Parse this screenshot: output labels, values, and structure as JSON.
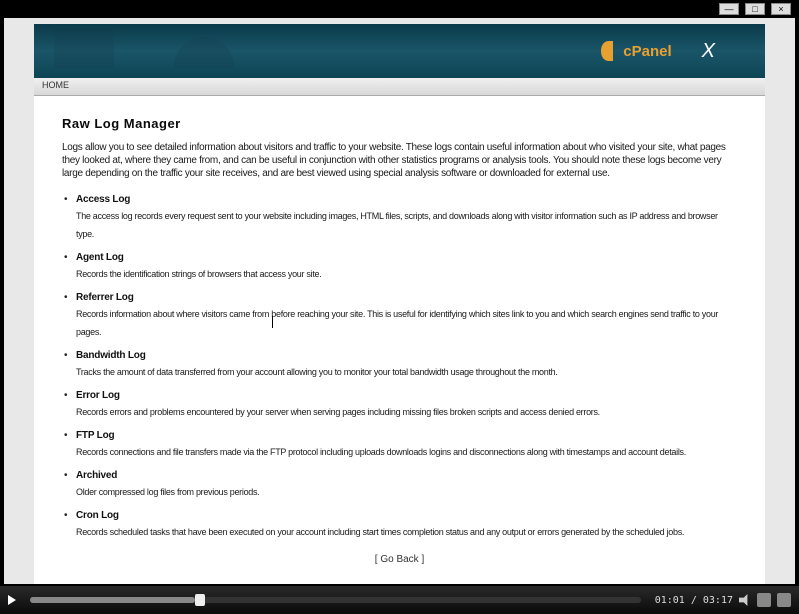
{
  "window": {
    "minimize": "—",
    "maximize": "□",
    "close": "×"
  },
  "header": {
    "logo_text": "cPanel",
    "theme_badge": "X"
  },
  "toolbar": {
    "breadcrumb": "HOME"
  },
  "page": {
    "title": "Raw Log Manager",
    "intro": "Logs allow you to see detailed information about visitors and traffic to your website. These logs contain useful information about who visited your site, what pages they looked at, where they came from, and can be useful in conjunction with other statistics programs or analysis tools. You should note these logs become very large depending on the traffic your site receives, and are best viewed using special analysis software or downloaded for external use.",
    "items": [
      {
        "name": "Access Log",
        "desc": "The access log records every request sent to your website including images, HTML files, scripts, and downloads along with visitor information such as IP address and browser type."
      },
      {
        "name": "Agent Log",
        "desc": "Records the identification strings of browsers that access your site."
      },
      {
        "name": "Referrer Log",
        "desc": "Records information about where visitors came from before reaching your site. This is useful for identifying which sites link to you and which search engines send traffic to your pages."
      },
      {
        "name": "Bandwidth Log",
        "desc": "Tracks the amount of data transferred from your account allowing you to monitor your total bandwidth usage throughout the month."
      },
      {
        "name": "Error Log",
        "desc": "Records errors and problems encountered by your server when serving pages including missing files broken scripts and access denied errors."
      },
      {
        "name": "FTP Log",
        "desc": "Records connections and file transfers made via the FTP protocol including uploads downloads logins and disconnections along with timestamps and account details."
      },
      {
        "name": "Archived",
        "desc": "Older compressed log files from previous periods."
      },
      {
        "name": "Cron Log",
        "desc": "Records scheduled tasks that have been executed on your account including start times completion status and any output or errors generated by the scheduled jobs."
      }
    ],
    "goback": "[ Go Back ]"
  },
  "player": {
    "time": "01:01 / 03:17"
  }
}
